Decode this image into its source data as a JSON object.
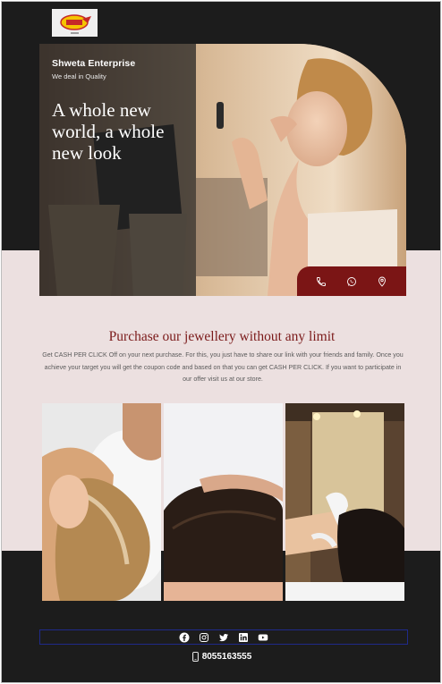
{
  "brand": {
    "name": "Shweta Enterprise",
    "tagline": "We deal in Quality",
    "logo_icon": "brand-logo"
  },
  "hero": {
    "title": "A whole new world, a whole new look",
    "contact_icons": [
      "phone-icon",
      "whatsapp-icon",
      "location-pin-icon"
    ]
  },
  "promo": {
    "title": "Purchase our jewellery without any limit",
    "body": "Get CASH PER CLICK Off on your next purchase. For this, you just have to share our link with your friends and family. Once you achieve your target you will get the coupon code and based on that you can get CASH PER CLICK. If you want to participate in our offer visit us at our store."
  },
  "gallery": {
    "images": [
      "hair-wash-photo",
      "hair-closeup-photo",
      "hair-coloring-photo"
    ]
  },
  "footer": {
    "social_icons": [
      "facebook-icon",
      "instagram-icon",
      "twitter-icon",
      "linkedin-icon",
      "youtube-icon"
    ],
    "phone": "8055163555"
  },
  "colors": {
    "dark_bg": "#1c1c1c",
    "light_bg": "#ece0e0",
    "accent": "#7b1515",
    "social_border": "#1f2a8a"
  }
}
